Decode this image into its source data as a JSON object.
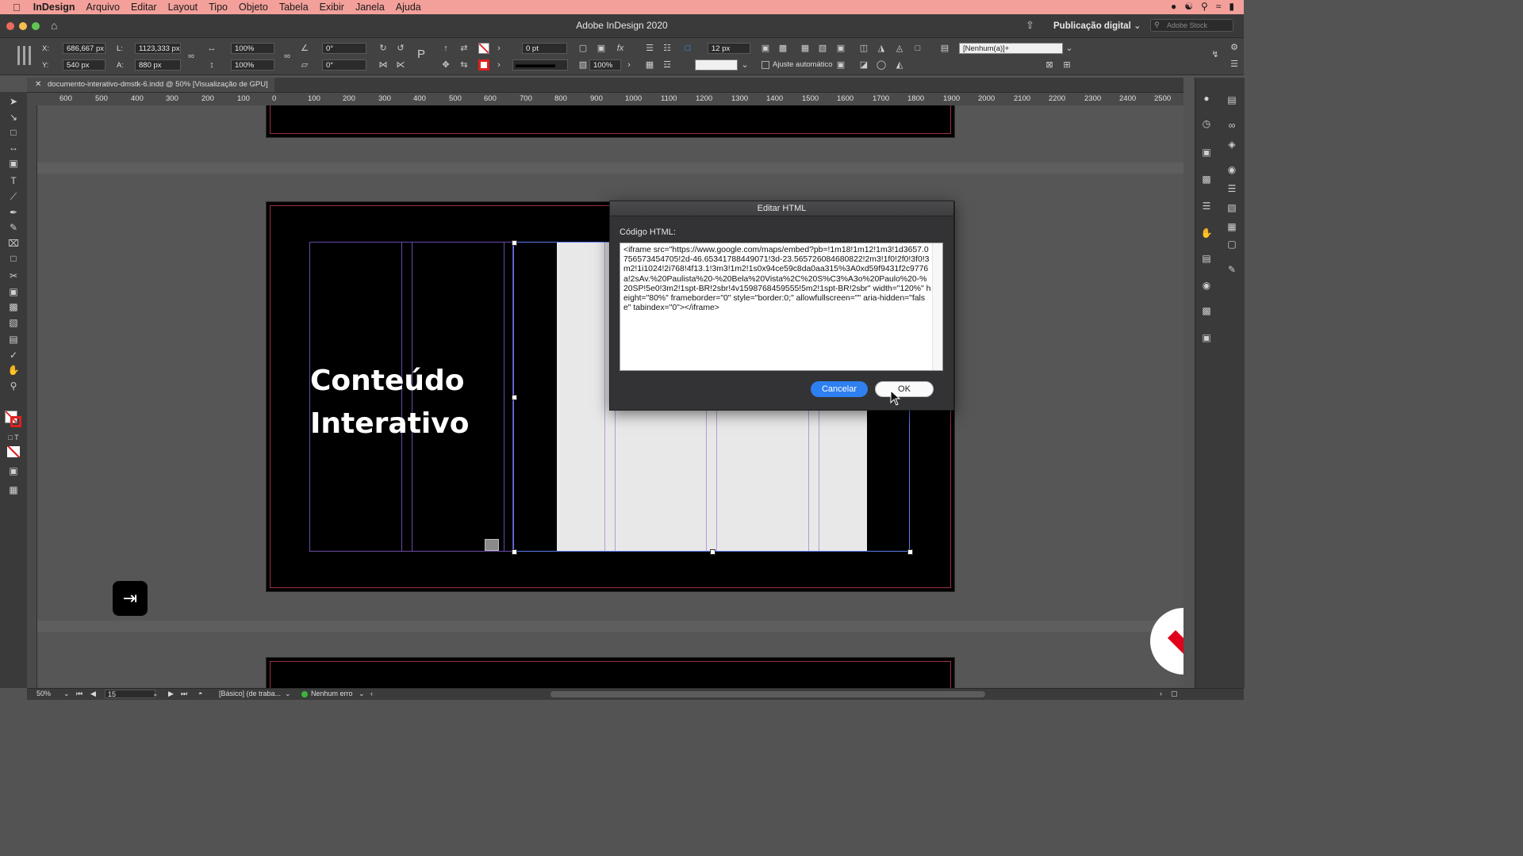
{
  "menubar": {
    "app_name": "InDesign",
    "items": [
      "Arquivo",
      "Editar",
      "Layout",
      "Tipo",
      "Objeto",
      "Tabela",
      "Exibir",
      "Janela",
      "Ajuda"
    ]
  },
  "titlebar": {
    "title": "Adobe InDesign 2020",
    "workspace": "Publicação digital",
    "stock_placeholder": "Adobe Stock"
  },
  "control": {
    "x_label": "X:",
    "x_value": "686,667 px",
    "y_label": "Y:",
    "y_value": "540 px",
    "w_label": "L:",
    "w_value": "1123,333 px",
    "h_label": "A:",
    "h_value": "880 px",
    "scale_x": "100%",
    "scale_y": "100%",
    "rotate": "0°",
    "shear": "0°",
    "stroke_weight": "0 pt",
    "opacity": "100%",
    "spacing": "12 px",
    "auto_fit_label": "Ajuste automático",
    "object_style": "[Nenhum(a)]+"
  },
  "document_tab": {
    "label": "documento-interativo-dmstk-6.indd @ 50% [Visualização de GPU]"
  },
  "ruler": {
    "labels": [
      "600",
      "500",
      "400",
      "300",
      "200",
      "100",
      "0",
      "100",
      "200",
      "300",
      "400",
      "500",
      "600",
      "700",
      "800",
      "900",
      "1000",
      "1100",
      "1200",
      "1300",
      "1400",
      "1500",
      "1600",
      "1700",
      "1800",
      "1900",
      "2000",
      "2100",
      "2200",
      "2300",
      "2400",
      "2500"
    ]
  },
  "page": {
    "heading_line1": "Conteúdo",
    "heading_line2": "Interativo"
  },
  "dialog": {
    "title": "Editar HTML",
    "code_label": "Código HTML:",
    "code": "<iframe src=\"https://www.google.com/maps/embed?pb=!1m18!1m12!1m3!1d3657.0756573454705!2d-46.65341788449071!3d-23.565726084680822!2m3!1f0!2f0!3f0!3m2!1i1024!2i768!4f13.1!3m3!1m2!1s0x94ce59c8da0aa315%3A0xd59f9431f2c9776a!2sAv.%20Paulista%20-%20Bela%20Vista%2C%20S%C3%A3o%20Paulo%20-%20SP!5e0!3m2!1spt-BR!2sbr!4v1598768459555!5m2!1spt-BR!2sbr\" width=\"120%\" height=\"80%\" frameborder=\"0\" style=\"border:0;\" allowfullscreen=\"\" aria-hidden=\"false\" tabindex=\"0\"></iframe>",
    "cancel_label": "Cancelar",
    "ok_label": "OK"
  },
  "status": {
    "zoom": "50%",
    "page_number": "15",
    "profile": "[Básico] (de traba...",
    "preflight": "Nenhum erro"
  },
  "colors": {
    "menubar_bg": "#f3a09a",
    "accent_blue": "#2e7ff0",
    "preflight_ok": "#3cb43c",
    "brand_red": "#e0001b"
  }
}
